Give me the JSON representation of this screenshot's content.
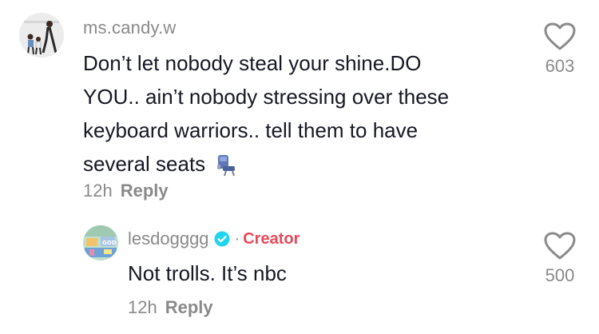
{
  "comment": {
    "username": "ms.candy.w",
    "text": "Don’t let nobody steal your shine.DO YOU.. ain’t nobody stressing over these keyboard warriors.. tell them to have several seats",
    "lines": [
      "Don’t let nobody steal your shine.DO",
      "YOU.. ain’t nobody stressing over these",
      "keyboard warriors.. tell them to have",
      "several seats"
    ],
    "emoji": "seat-emoji",
    "time": "12h",
    "reply_label": "Reply",
    "likes": "603",
    "like_icon": "heart-outline-icon"
  },
  "reply": {
    "username": "lesdogggg",
    "verified_icon": "verified-badge-icon",
    "separator": "·",
    "badge": "Creator",
    "text": "Not trolls. It’s nbc",
    "time": "12h",
    "reply_label": "Reply",
    "likes": "500",
    "like_icon": "heart-outline-icon"
  },
  "colors": {
    "text": "#161823",
    "muted": "#8a8a8a",
    "creator": "#e8495a",
    "verified": "#20d5ec"
  }
}
